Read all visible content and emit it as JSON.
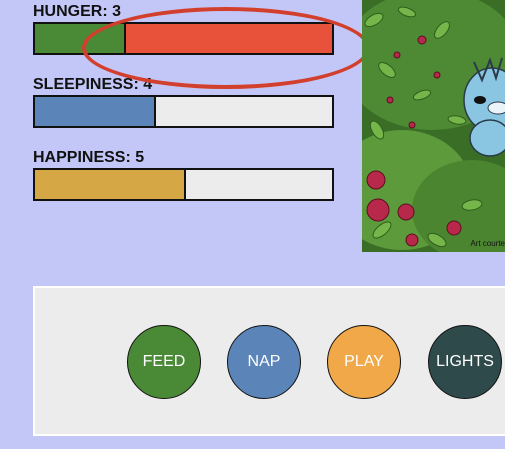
{
  "stats": {
    "hunger": {
      "label": "HUNGER: 3",
      "filled_fraction": 0.3,
      "fill_color": "#4a8a36",
      "empty_color": "#e8513a"
    },
    "sleepiness": {
      "label": "SLEEPINESS: 4",
      "filled_fraction": 0.4,
      "fill_color": "#5b84b8",
      "empty_color": "#ececec"
    },
    "happiness": {
      "label": "HAPPINESS: 5",
      "filled_fraction": 0.5,
      "fill_color": "#d5a845",
      "empty_color": "#ececec"
    }
  },
  "highlight_color": "#d23f2c",
  "art": {
    "credit": "Art courte"
  },
  "actions": [
    {
      "label": "FEED",
      "color": "#4a8a36"
    },
    {
      "label": "NAP",
      "color": "#5b84b8"
    },
    {
      "label": "PLAY",
      "color": "#f0a848"
    },
    {
      "label": "LIGHTS",
      "color": "#2e4a4a"
    }
  ]
}
